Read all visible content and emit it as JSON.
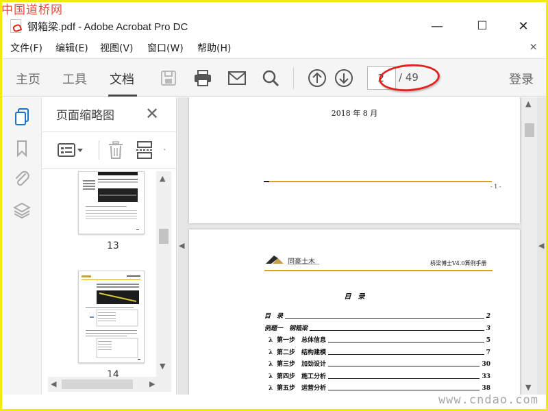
{
  "watermark": {
    "top": "中国道桥网",
    "bottom": "www.cndao.com"
  },
  "window": {
    "title": "钢箱梁.pdf - Adobe Acrobat Pro DC",
    "minimize": "—",
    "maximize": "☐",
    "close": "✕"
  },
  "menu": {
    "items": [
      "文件(F)",
      "编辑(E)",
      "视图(V)",
      "窗口(W)",
      "帮助(H)"
    ],
    "close": "×"
  },
  "toolbar": {
    "tabs": [
      "主页",
      "工具",
      "文档"
    ],
    "active_tab": "文档",
    "page_current": "2",
    "page_total": "/ 49",
    "login": "登录",
    "icons": [
      "save-icon",
      "print-icon",
      "email-icon",
      "search-icon",
      "previous-page-icon",
      "next-page-icon"
    ]
  },
  "left_rail": {
    "icons": [
      "page-thumbnails-icon",
      "bookmark-icon",
      "attachment-icon",
      "layers-icon"
    ]
  },
  "thumb_panel": {
    "title": "页面缩略图",
    "close": "✕",
    "thumbnails": [
      {
        "label": "13"
      },
      {
        "label": "14"
      }
    ]
  },
  "document": {
    "page1": {
      "date": "2018 年 8 月",
      "page_number": "- 1 -"
    },
    "page2": {
      "logo_text": "同豪土木",
      "header_right": "桥梁博士V4.0算例手册",
      "toc_title": "目　录",
      "toc": [
        {
          "indent": false,
          "bullet": "",
          "text": "目　录",
          "page": "2"
        },
        {
          "indent": false,
          "bullet": "",
          "text": "例题一　钢箱梁",
          "page": "3"
        },
        {
          "indent": true,
          "bullet": "λ",
          "text": "第一步　总体信息",
          "page": "5"
        },
        {
          "indent": true,
          "bullet": "λ",
          "text": "第二步　结构建模",
          "page": "7"
        },
        {
          "indent": true,
          "bullet": "λ",
          "text": "第三步　加劲设计",
          "page": "30"
        },
        {
          "indent": true,
          "bullet": "λ",
          "text": "第四步　施工分析",
          "page": "33"
        },
        {
          "indent": true,
          "bullet": "λ",
          "text": "第五步　运营分析",
          "page": "38"
        }
      ]
    }
  },
  "colors": {
    "frame": "#f1eb0a",
    "annotation": "#e02520",
    "accent_line": "#d7a41b"
  }
}
